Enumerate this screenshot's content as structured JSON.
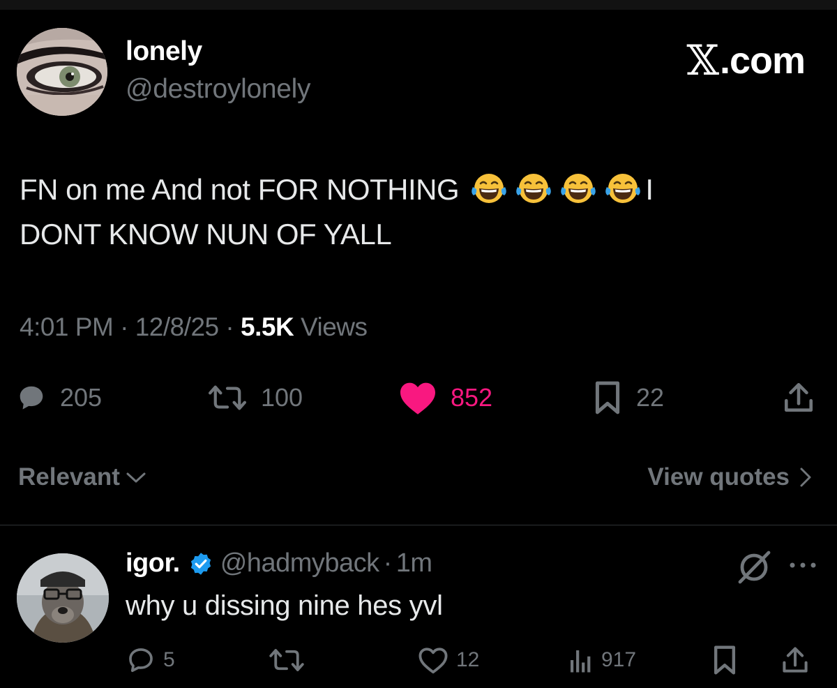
{
  "author": {
    "display_name": "lonely",
    "handle": "@destroylonely",
    "avatar": "avatar-eye-closeup"
  },
  "watermark": {
    "glyph": "𝕏",
    "domain": ".com"
  },
  "tweet": {
    "text_part1": "FN on me And not FOR NOTHING",
    "emoji": "face-with-tears-of-joy",
    "emoji_count": 4,
    "text_part2": "I",
    "text_part3": "DONT KNOW NUN OF YALL",
    "time": "4:01 PM",
    "date": "12/8/25",
    "separator": "·",
    "views_count": "5.5K",
    "views_label": "Views"
  },
  "actions": {
    "replies": "205",
    "reposts": "100",
    "likes": "852",
    "bookmarks": "22",
    "like_color": "#f91880"
  },
  "filter": {
    "sort_label": "Relevant",
    "view_quotes_label": "View quotes"
  },
  "reply": {
    "display_name": "igor.",
    "handle": "@hadmyback",
    "separator": "·",
    "time": "1m",
    "text": "why u dissing nine hes yvl",
    "replies": "5",
    "reposts": "",
    "likes": "12",
    "views": "917",
    "verified_color": "#1d9bf0"
  },
  "colors": {
    "background": "#000000",
    "text": "#e7e9ea",
    "muted": "#71767b",
    "divider": "#2f3336"
  }
}
